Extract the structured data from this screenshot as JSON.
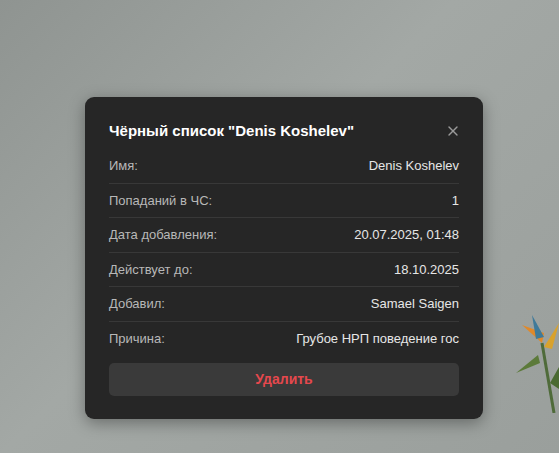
{
  "dialog": {
    "title": "Чёрный список \"Denis Koshelev\"",
    "rows": [
      {
        "label": "Имя:",
        "value": "Denis Koshelev"
      },
      {
        "label": "Попаданий в ЧС:",
        "value": "1"
      },
      {
        "label": "Дата добавления:",
        "value": "20.07.2025, 01:48"
      },
      {
        "label": "Действует до:",
        "value": "18.10.2025"
      },
      {
        "label": "Добавил:",
        "value": "Samael Saigen"
      },
      {
        "label": "Причина:",
        "value": "Грубое НРП поведение гос"
      }
    ],
    "buttons": [
      "Удалить"
    ]
  }
}
